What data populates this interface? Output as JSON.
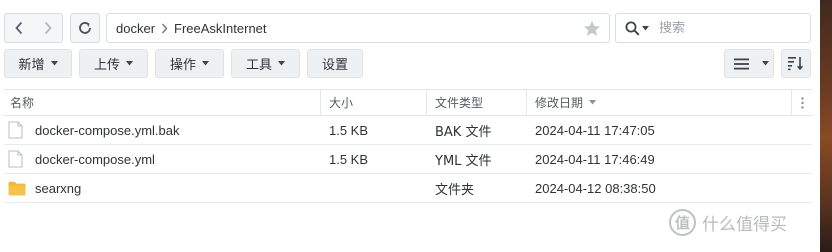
{
  "nav": {
    "back_icon": "chevron-left-icon",
    "forward_icon": "chevron-right-icon",
    "refresh_icon": "refresh-icon"
  },
  "address": {
    "path": [
      "docker",
      "FreeAskInternet"
    ],
    "favorite_icon": "star-icon"
  },
  "search": {
    "placeholder": "搜索",
    "icon": "search-icon"
  },
  "toolbar": {
    "new_label": "新增",
    "upload_label": "上传",
    "action_label": "操作",
    "tools_label": "工具",
    "settings_label": "设置",
    "view_icon": "list-view-icon",
    "sort_icon": "sort-icon"
  },
  "table": {
    "columns": [
      "名称",
      "大小",
      "文件类型",
      "修改日期"
    ],
    "sorted_column": "修改日期",
    "rows": [
      {
        "icon": "file-icon",
        "name": "docker-compose.yml.bak",
        "size": "1.5 KB",
        "type": "BAK 文件",
        "modified": "2024-04-11 17:47:05"
      },
      {
        "icon": "file-icon",
        "name": "docker-compose.yml",
        "size": "1.5 KB",
        "type": "YML 文件",
        "modified": "2024-04-11 17:46:49"
      },
      {
        "icon": "folder-icon",
        "name": "searxng",
        "size": "",
        "type": "文件夹",
        "modified": "2024-04-12 08:38:50"
      }
    ]
  },
  "watermark": {
    "logo_text": "值",
    "text": "什么值得买"
  },
  "colors": {
    "border": "#d7dde2",
    "button_bg": "#eef1f3",
    "folder": "#f5b733",
    "icon": "#5b636a"
  }
}
